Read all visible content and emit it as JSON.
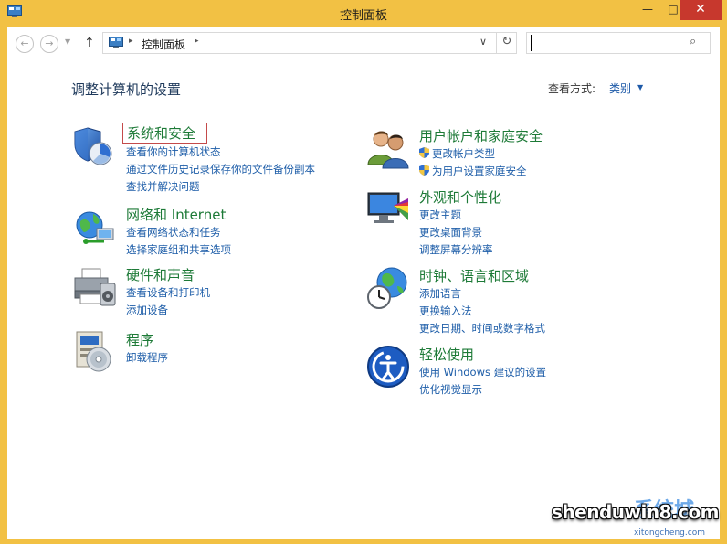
{
  "window": {
    "title": "控制面板",
    "minimize_glyph": "—",
    "maximize_glyph": "□",
    "close_glyph": "✕"
  },
  "nav": {
    "back_glyph": "←",
    "forward_glyph": "→",
    "recent_glyph": "▼",
    "up_glyph": "↑",
    "address_sep": "▸",
    "breadcrumb": "控制面板",
    "dropdown_glyph": "∨",
    "refresh_glyph": "↻",
    "search_value": "",
    "search_icon": "search-icon"
  },
  "heading": "调整计算机的设置",
  "view_by": {
    "label": "查看方式:",
    "value": "类别",
    "arrow": "▼"
  },
  "categories": [
    {
      "title": "系统和安全",
      "icon": "shield-icon",
      "links": [
        "查看你的计算机状态",
        "通过文件历史记录保存你的文件备份副本",
        "查找并解决问题"
      ]
    },
    {
      "title": "网络和 Internet",
      "icon": "network-icon",
      "links": [
        "查看网络状态和任务",
        "选择家庭组和共享选项"
      ]
    },
    {
      "title": "硬件和声音",
      "icon": "printer-icon",
      "links": [
        "查看设备和打印机",
        "添加设备"
      ]
    },
    {
      "title": "程序",
      "icon": "programs-icon",
      "links": [
        "卸载程序"
      ]
    },
    {
      "title": "用户帐户和家庭安全",
      "icon": "users-icon",
      "links": [
        "更改帐户类型",
        "为用户设置家庭安全"
      ]
    },
    {
      "title": "外观和个性化",
      "icon": "appearance-icon",
      "links": [
        "更改主题",
        "更改桌面背景",
        "调整屏幕分辨率"
      ]
    },
    {
      "title": "时钟、语言和区域",
      "icon": "clock-globe-icon",
      "links": [
        "添加语言",
        "更换输入法",
        "更改日期、时间或数字格式"
      ]
    },
    {
      "title": "轻松使用",
      "icon": "ease-of-access-icon",
      "links": [
        "使用 Windows 建议的设置",
        "优化视觉显示"
      ]
    }
  ],
  "watermark": {
    "main": "shenduwin8.com",
    "cn": "系统城",
    "sub": "xitongcheng.com"
  },
  "colors": {
    "titlebar": "#f2c144",
    "close": "#c7382d",
    "category_title": "#1d7a37",
    "link": "#1d5da8",
    "heading": "#1e395b"
  }
}
